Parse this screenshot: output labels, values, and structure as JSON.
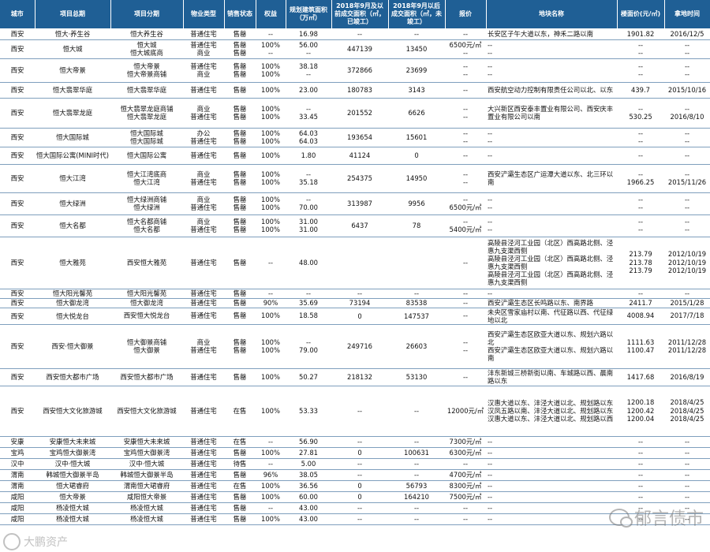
{
  "headers": [
    "城市",
    "项目总期",
    "项目分期",
    "物业类型",
    "销售状态",
    "权益",
    "规划建筑面积（万㎡）",
    "2018年9月及以前成交面积（㎡，已竣工）",
    "2018年9月以后成交面积（㎡，未竣工）",
    "报价",
    "地块名称",
    "楼面价(元/㎡)",
    "拿地时间"
  ],
  "rows": [
    {
      "h": 14,
      "c": [
        "西安",
        "恒大·养生谷",
        [
          "恒大养生谷"
        ],
        [
          "普通住宅"
        ],
        [
          "售罄"
        ],
        [
          "--"
        ],
        [
          "16.98"
        ],
        "--",
        "--",
        [
          "--"
        ],
        [
          "长安区子午大道以东，神禾二路以南"
        ],
        [
          "1901.82"
        ],
        [
          "2016/12/5"
        ]
      ]
    },
    {
      "h": 24,
      "c": [
        "西安",
        "恒大城",
        [
          "恒大城",
          "恒大城底商"
        ],
        [
          "普通住宅",
          "商业"
        ],
        [
          "售罄",
          "售罄"
        ],
        [
          "100%",
          "--"
        ],
        [
          "56.00",
          "--"
        ],
        "447139",
        "13450",
        [
          "6500元/㎡",
          "--"
        ],
        [
          "--",
          "--"
        ],
        [
          "--",
          "--"
        ],
        [
          "--",
          "--"
        ]
      ]
    },
    {
      "h": 30,
      "c": [
        "西安",
        "恒大帝景",
        [
          "恒大帝景",
          "恒大帝景商铺"
        ],
        [
          "普通住宅",
          "商业"
        ],
        [
          "售罄",
          "售罄"
        ],
        [
          "100%",
          "100%"
        ],
        [
          "38.18",
          "--"
        ],
        "372866",
        "23699",
        [
          "--",
          "--"
        ],
        [
          "--",
          "--"
        ],
        [
          "--",
          "--"
        ],
        [
          "--",
          "--"
        ]
      ]
    },
    {
      "h": 20,
      "c": [
        "西安",
        "恒大翡翠华庭",
        [
          "恒大翡翠华庭"
        ],
        [
          "普通住宅"
        ],
        [
          "售罄"
        ],
        [
          "100%"
        ],
        [
          "23.00"
        ],
        "180783",
        "3143",
        [
          "--"
        ],
        [
          "西安航空动力控制有限责任公司以北、以东"
        ],
        [
          "439.7"
        ],
        [
          "2015/10/16"
        ]
      ]
    },
    {
      "h": 38,
      "c": [
        "西安",
        "恒大翡翠龙庭",
        [
          "恒大翡翠龙庭商铺",
          "恒大翡翠龙庭"
        ],
        [
          "商业",
          "普通住宅"
        ],
        [
          "售罄",
          "售罄"
        ],
        [
          "100%",
          "100%"
        ],
        [
          "--",
          "33.45"
        ],
        "201552",
        "6626",
        [
          "--",
          "--"
        ],
        [
          "大兴新区西安泰丰置业有限公司、西安庆丰置业有限公司以南"
        ],
        [
          "--",
          "530.25"
        ],
        [
          "--",
          "2016/8/10"
        ]
      ]
    },
    {
      "h": 24,
      "c": [
        "西安",
        "恒大国际城",
        [
          "恒大国际城",
          "恒大国际城"
        ],
        [
          "办公",
          "普通住宅"
        ],
        [
          "售罄",
          "售罄"
        ],
        [
          "100%",
          "100%"
        ],
        [
          "64.03",
          "64.03"
        ],
        "193654",
        "15601",
        [
          "--",
          "--"
        ],
        [
          "--",
          "--"
        ],
        [
          "--",
          "--"
        ],
        [
          "--",
          "--"
        ]
      ]
    },
    {
      "h": 22,
      "c": [
        "西安",
        "恒大国际公寓(MINI时代)",
        [
          "恒大国际公寓"
        ],
        [
          "普通住宅"
        ],
        [
          "售罄"
        ],
        [
          "100%"
        ],
        [
          "1.80"
        ],
        "41124",
        "0",
        [
          "--"
        ],
        [
          "--"
        ],
        [
          "--"
        ],
        [
          "--"
        ]
      ]
    },
    {
      "h": 36,
      "c": [
        "西安",
        "恒大江湾",
        [
          "恒大江湾底商",
          "恒大江湾"
        ],
        [
          "商业",
          "普通住宅"
        ],
        [
          "售罄",
          "售罄"
        ],
        [
          "100%",
          "100%"
        ],
        [
          "--",
          "35.18"
        ],
        "254375",
        "14950",
        [
          "--",
          "--"
        ],
        [
          "西安浐灞生态区广运潭大道以东、北三环以南"
        ],
        [
          "--",
          "1966.25"
        ],
        [
          "--",
          "2015/11/26"
        ]
      ]
    },
    {
      "h": 28,
      "c": [
        "西安",
        "恒大绿洲",
        [
          "恒大绿洲商铺",
          "恒大绿洲"
        ],
        [
          "商业",
          "普通住宅"
        ],
        [
          "售罄",
          "售罄"
        ],
        [
          "100%",
          "100%"
        ],
        [
          "--",
          "70.00"
        ],
        "313987",
        "9956",
        [
          "--",
          "6500元/㎡"
        ],
        [
          "--",
          "--"
        ],
        [
          "--",
          "--"
        ],
        [
          "--",
          "--"
        ]
      ]
    },
    {
      "h": 28,
      "c": [
        "西安",
        "恒大名都",
        [
          "恒大名都商铺",
          "恒大名都"
        ],
        [
          "商业",
          "普通住宅"
        ],
        [
          "售罄",
          "售罄"
        ],
        [
          "100%",
          "100%"
        ],
        [
          "31.00",
          "31.00"
        ],
        "6437",
        "78",
        [
          "--",
          "5400元/㎡"
        ],
        [
          "--",
          "--"
        ],
        [
          "--",
          "--"
        ],
        [
          "--",
          "--"
        ]
      ]
    },
    {
      "h": 66,
      "c": [
        "西安",
        "恒大雅苑",
        [
          "西安恒大雅苑"
        ],
        [
          "普通住宅"
        ],
        [
          "售罄"
        ],
        [
          "--"
        ],
        [
          "48.00"
        ],
        "",
        "",
        [
          "--"
        ],
        [
          "高陵县泾河工业园（北区）西高路北侧、泾惠九支渠西侧",
          "高陵县泾河工业园（北区）西高路北侧、泾惠九支渠西侧",
          "高陵县泾河工业园（北区）西高路北侧、泾惠九支渠西侧"
        ],
        [
          "213.79",
          "213.78",
          "213.79"
        ],
        [
          "2012/10/19",
          "2012/10/19",
          "2012/10/19"
        ]
      ]
    },
    {
      "h": 12,
      "c": [
        "西安",
        "恒大阳光馨苑",
        [
          "恒大阳光馨苑"
        ],
        [
          "普通住宅"
        ],
        [
          "售罄"
        ],
        [
          "--"
        ],
        [
          "--"
        ],
        "--",
        "--",
        [
          "--"
        ],
        [
          "--"
        ],
        [
          "--"
        ],
        [
          "--"
        ]
      ]
    },
    {
      "h": 12,
      "c": [
        "西安",
        "恒大御龙湾",
        [
          "恒大御龙湾"
        ],
        [
          "普通住宅"
        ],
        [
          "售罄"
        ],
        [
          "90%"
        ],
        [
          "35.69"
        ],
        "73194",
        "83538",
        [
          "--"
        ],
        [
          "西安浐灞生态区长鸣路以东、南界路"
        ],
        [
          "2411.7"
        ],
        [
          "2015/1/28"
        ]
      ]
    },
    {
      "h": 20,
      "c": [
        "西安",
        "恒大悦龙台",
        [
          "西安恒大悦龙台"
        ],
        [
          "普通住宅"
        ],
        [
          "售罄"
        ],
        [
          "100%"
        ],
        [
          "18.58"
        ],
        "0",
        "147537",
        [
          "--"
        ],
        [
          "未央区雪家庙村以南、代征路以西、代征绿地以北"
        ],
        [
          "4008.94"
        ],
        [
          "2017/7/18"
        ]
      ]
    },
    {
      "h": 56,
      "c": [
        "西安",
        "西安·恒大御景",
        [
          "恒大御景商铺",
          "恒大御景"
        ],
        [
          "商业",
          "普通住宅"
        ],
        [
          "售罄",
          "售罄"
        ],
        [
          "100%",
          "100%"
        ],
        [
          "--",
          "79.00"
        ],
        "249716",
        "26603",
        [
          "--",
          "--"
        ],
        [
          "西安浐灞生态区欧亚大道以东、规划六路以北",
          "西安浐灞生态区欧亚大道以东、规划六路以南"
        ],
        [
          "1111.63",
          "1100.47"
        ],
        [
          "2011/12/28",
          "2011/12/28"
        ]
      ]
    },
    {
      "h": 22,
      "c": [
        "西安",
        "西安恒大都市广场",
        [
          "西安恒大都市广场"
        ],
        [
          "普通住宅"
        ],
        [
          "售罄"
        ],
        [
          "100%"
        ],
        [
          "50.27"
        ],
        "218132",
        "53130",
        [
          "--"
        ],
        [
          "沣东新城三桥新街以南、车城路以西、晨南路以东"
        ],
        [
          "1417.68"
        ],
        [
          "2016/8/19"
        ]
      ]
    },
    {
      "h": 64,
      "c": [
        "西安",
        "西安恒大文化旅游城",
        [
          "西安恒大文化旅游城"
        ],
        [
          "普通住宅"
        ],
        [
          "在售"
        ],
        [
          "100%"
        ],
        [
          "53.33"
        ],
        "--",
        "--",
        [
          "12000元/㎡"
        ],
        [
          "汉惠大道以东、沣泾大道以北、规划路以东",
          "汉凤五路以南、沣泾大道以北、规划路以东",
          "汉惠大道以东、沣泾大道以北、规划路以西"
        ],
        [
          "1200.18",
          "1200.42",
          "1200.04"
        ],
        [
          "2018/4/25",
          "2018/4/25",
          "2018/4/25"
        ]
      ]
    },
    {
      "h": 14,
      "c": [
        "安康",
        "安康恒大未来城",
        [
          "安康恒大未来城"
        ],
        [
          "普通住宅"
        ],
        [
          "在售"
        ],
        [
          "--"
        ],
        [
          "56.90"
        ],
        "--",
        "--",
        [
          "7300元/㎡"
        ],
        [
          "--"
        ],
        [
          "--"
        ],
        [
          "--"
        ]
      ]
    },
    {
      "h": 14,
      "c": [
        "宝鸡",
        "宝鸡恒大御景湾",
        [
          "宝鸡恒大御景湾"
        ],
        [
          "普通住宅"
        ],
        [
          "售罄"
        ],
        [
          "100%"
        ],
        [
          "27.81"
        ],
        "0",
        "100631",
        [
          "6300元/㎡"
        ],
        [
          "--"
        ],
        [
          "--"
        ],
        [
          "--"
        ]
      ]
    },
    {
      "h": 14,
      "c": [
        "汉中",
        "汉中·恒大城",
        [
          "汉中·恒大城"
        ],
        [
          "普通住宅"
        ],
        [
          "待售"
        ],
        [
          "--"
        ],
        [
          "5.00"
        ],
        "--",
        "--",
        [
          "--"
        ],
        [
          "--"
        ],
        [
          "--"
        ],
        [
          "--"
        ]
      ]
    },
    {
      "h": 14,
      "c": [
        "渭南",
        "韩城恒大御景半岛",
        [
          "韩城恒大御景半岛"
        ],
        [
          "普通住宅"
        ],
        [
          "售罄"
        ],
        [
          "96%"
        ],
        [
          "38.05"
        ],
        "--",
        "--",
        [
          "4700元/㎡"
        ],
        [
          "--"
        ],
        [
          "--"
        ],
        [
          "--"
        ]
      ]
    },
    {
      "h": 14,
      "c": [
        "渭南",
        "恒大珺睿府",
        [
          "渭南恒大珺睿府"
        ],
        [
          "普通住宅"
        ],
        [
          "在售"
        ],
        [
          "100%"
        ],
        [
          "36.56"
        ],
        "0",
        "56793",
        [
          "8300元/㎡"
        ],
        [
          "--"
        ],
        [
          "--"
        ],
        [
          "--"
        ]
      ]
    },
    {
      "h": 14,
      "c": [
        "咸阳",
        "恒大帝景",
        [
          "咸阳恒大帝景"
        ],
        [
          "普通住宅"
        ],
        [
          "售罄"
        ],
        [
          "100%"
        ],
        [
          "60.00"
        ],
        "0",
        "164210",
        [
          "7500元/㎡"
        ],
        [
          "--"
        ],
        [
          "--"
        ],
        [
          "--"
        ]
      ]
    },
    {
      "h": 14,
      "c": [
        "咸阳",
        "杨凌恒大城",
        [
          "杨凌恒大城"
        ],
        [
          "普通住宅"
        ],
        [
          "售罄"
        ],
        [
          "--"
        ],
        [
          "43.00"
        ],
        "--",
        "--",
        [
          "--"
        ],
        [
          "--"
        ],
        [
          "--"
        ],
        [
          "--"
        ]
      ]
    },
    {
      "h": 14,
      "c": [
        "咸阳",
        "杨凌恒大城",
        [
          "杨凌恒大城"
        ],
        [
          "普通住宅"
        ],
        [
          "售罄"
        ],
        [
          "100%"
        ],
        [
          "43.00"
        ],
        "--",
        "--",
        [
          "--"
        ],
        [
          "--"
        ],
        [
          "--"
        ],
        [
          "--"
        ]
      ]
    }
  ],
  "watermark_right": "郁言债市",
  "watermark_left": "大鹏资产"
}
